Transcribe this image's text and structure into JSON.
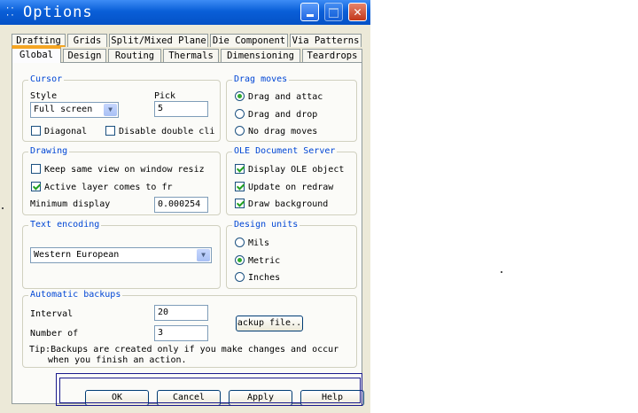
{
  "window": {
    "title": "Options"
  },
  "tabs_row1": [
    "Drafting",
    "Grids",
    "Split/Mixed Plane",
    "Die Component",
    "Via Patterns"
  ],
  "tabs_row2": [
    "Global",
    "Design",
    "Routing",
    "Thermals",
    "Dimensioning",
    "Teardrops"
  ],
  "active_tab": "Global",
  "cursor": {
    "title": "Cursor",
    "style_label": "Style",
    "style_value": "Full screen",
    "pick_label": "Pick",
    "pick_value": "5",
    "diagonal_label": "Diagonal",
    "diagonal_checked": false,
    "disable_dbl_label": "Disable double cli",
    "disable_dbl_checked": false
  },
  "drag_moves": {
    "title": "Drag moves",
    "options": [
      "Drag and attac",
      "Drag and drop",
      "No drag moves"
    ],
    "selected": 0
  },
  "drawing": {
    "title": "Drawing",
    "keep_view_label": "Keep same view on window resiz",
    "keep_view_checked": false,
    "active_layer_label": "Active layer comes to fr",
    "active_layer_checked": true,
    "min_display_label": "Minimum display",
    "min_display_value": "0.000254"
  },
  "ole": {
    "title": "OLE Document Server",
    "items": [
      {
        "label": "Display OLE object",
        "checked": true
      },
      {
        "label": "Update on redraw",
        "checked": true
      },
      {
        "label": "Draw background",
        "checked": true
      }
    ]
  },
  "text_encoding": {
    "title": "Text encoding",
    "value": "Western European"
  },
  "design_units": {
    "title": "Design units",
    "options": [
      "Mils",
      "Metric",
      "Inches"
    ],
    "selected": 1
  },
  "backups": {
    "title": "Automatic backups",
    "interval_label": "Interval",
    "interval_value": "20",
    "number_label": "Number of",
    "number_value": "3",
    "file_button": "ackup file..",
    "tip_line1": "Tip:Backups are created only if you make changes and occur",
    "tip_line2": "when you finish an action."
  },
  "buttons": {
    "ok": "OK",
    "cancel": "Cancel",
    "apply": "Apply",
    "help": "Help"
  }
}
